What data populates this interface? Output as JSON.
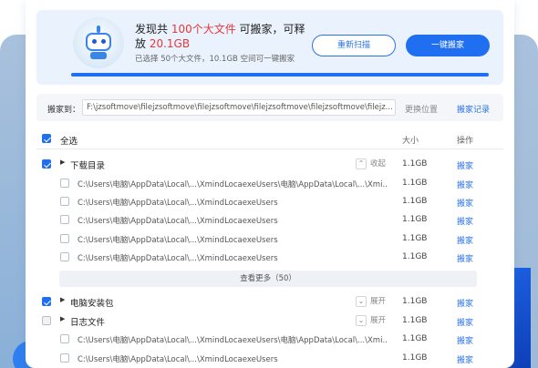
{
  "scan": {
    "title_prefix": "发现共 ",
    "file_count": "100个大文件",
    "title_mid": " 可搬家，可释放 ",
    "size": "20.1GB",
    "subtitle": "已选择 50个大文件，10.1GB 空间可一键搬家",
    "rescan_label": "重新扫描",
    "move_label": "一键搬家",
    "progress": 1.0
  },
  "path": {
    "label": "搬家到：",
    "value": "F:\\jzsoftmove\\filejzsoftmove\\filejzsoftmove\\filejzsoftmove\\filejzsoftmove\\filejz...",
    "change_label": "更换位置",
    "record_label": "搬家记录"
  },
  "table": {
    "select_all": "全选",
    "col_size": "大小",
    "col_action": "操作"
  },
  "groups": [
    {
      "name": "下载目录",
      "toggle": "收起",
      "size": "1.1GB",
      "action": "搬家",
      "checked": true,
      "files": [
        {
          "path": "C:\\Users\\电脑\\AppData\\Local\\...\\XmindLocaexeUsers\\电脑\\AppData\\Local\\...\\Xmi...",
          "size": "1.1GB",
          "action": "搬家"
        },
        {
          "path": "C:\\Users\\电脑\\AppData\\Local\\...\\XmindLocaexeUsers",
          "size": "1.1GB",
          "action": "搬家"
        },
        {
          "path": "C:\\Users\\电脑\\AppData\\Local\\...\\XmindLocaexeUsers",
          "size": "1.1GB",
          "action": "搬家"
        },
        {
          "path": "C:\\Users\\电脑\\AppData\\Local\\...\\XmindLocaexeUsers",
          "size": "1.1GB",
          "action": "搬家"
        },
        {
          "path": "C:\\Users\\电脑\\AppData\\Local\\...\\XmindLocaexeUsers",
          "size": "1.1GB",
          "action": "搬家"
        }
      ],
      "more_label": "查看更多（50）"
    },
    {
      "name": "电脑安装包",
      "toggle": "展开",
      "size": "1.1GB",
      "action": "搬家",
      "checked": true
    },
    {
      "name": "日志文件",
      "toggle": "展开",
      "size": "1.1GB",
      "action": "搬家",
      "checked": false,
      "files": [
        {
          "path": "C:\\Users\\电脑\\AppData\\Local\\...\\XmindLocaexeUsers\\电脑\\AppData\\Local\\...\\Xmi...",
          "size": "1.1GB",
          "action": "搬家"
        },
        {
          "path": "C:\\Users\\电脑\\AppData\\Local\\...\\XmindLocaexeUsers",
          "size": "1.1GB",
          "action": "搬家"
        }
      ]
    }
  ],
  "colors": {
    "accent": "#1f6ff0",
    "highlight": "#e5383b",
    "link": "#2a73e6"
  }
}
